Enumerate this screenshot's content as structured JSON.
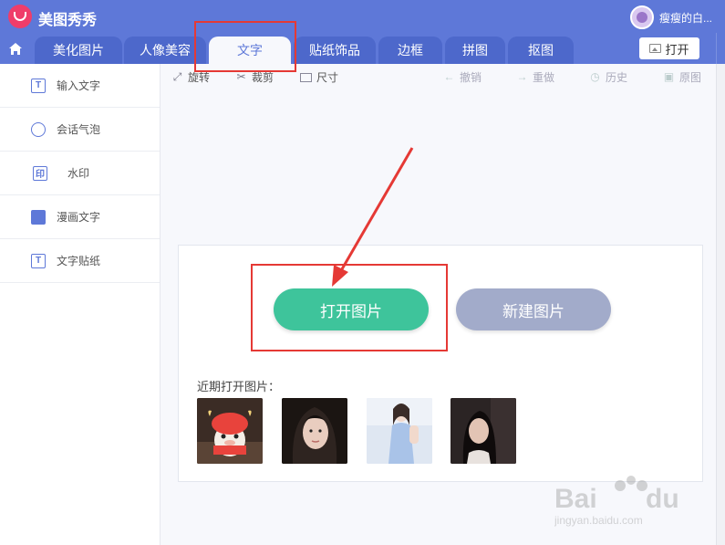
{
  "app": {
    "title": "美图秀秀",
    "user_name": "瘦瘦的白..."
  },
  "tabs": [
    {
      "label": "美化图片"
    },
    {
      "label": "人像美容"
    },
    {
      "label": "文字",
      "active": true
    },
    {
      "label": "贴纸饰品"
    },
    {
      "label": "边框"
    },
    {
      "label": "拼图"
    },
    {
      "label": "抠图"
    }
  ],
  "header": {
    "open_label": "打开"
  },
  "sidebar": {
    "items": [
      {
        "label": "输入文字",
        "icon": "text-icon"
      },
      {
        "label": "会话气泡",
        "icon": "speech-bubble-icon"
      },
      {
        "label": "水印",
        "icon": "watermark-icon"
      },
      {
        "label": "漫画文字",
        "icon": "comic-text-icon"
      },
      {
        "label": "文字贴纸",
        "icon": "text-sticker-icon"
      }
    ]
  },
  "toolbar": {
    "rotate": "旋转",
    "crop": "裁剪",
    "size": "尺寸",
    "undo": "撤销",
    "redo": "重做",
    "history": "历史",
    "original": "原图"
  },
  "main": {
    "open_image": "打开图片",
    "new_image": "新建图片",
    "recent_label": "近期打开图片："
  },
  "colors": {
    "brand_blue": "#5e78d8",
    "open_green": "#3ec49b",
    "new_grey": "#a2abca",
    "annotation_red": "#e53935"
  }
}
